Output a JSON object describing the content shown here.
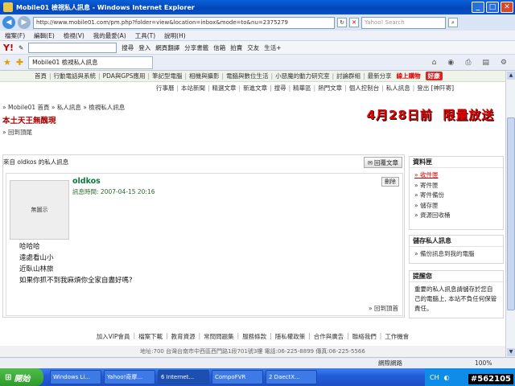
{
  "window": {
    "title": "Mobile01 檢視私人訊息 - Windows Internet Explorer"
  },
  "address": {
    "url": "http://www.mobile01.com/pm.php?folder=view&location=inbox&mode=to&nu=2375279",
    "search_placeholder": "Yahoo! Search"
  },
  "menu": [
    "檔案(F)",
    "編輯(E)",
    "檢視(V)",
    "我的最愛(A)",
    "工具(T)",
    "說明(H)"
  ],
  "toolbar1": {
    "search_btn": "搜尋",
    "login": "登入",
    "translate": "網頁翻譯",
    "share": "分享書籤",
    "mail": "信箱",
    "auction": "拍賣",
    "friends": "交友",
    "life": "生活+"
  },
  "tab": {
    "label": "Mobile01 檢視私人訊息"
  },
  "sitenav": {
    "items": [
      "首頁",
      "行動電話與系統",
      "PDA與GPS應用",
      "筆記型電腦",
      "相機與攝影",
      "電腦與數位生活",
      "小惡魔的動力研究室",
      "討論群組",
      "最新分享"
    ],
    "highlight": "線上購物",
    "badge": "好康"
  },
  "subnav": {
    "items": [
      "行事曆",
      "本站新聞",
      "精選文章",
      "新進文章",
      "搜尋",
      "精華區",
      "熱門文章",
      "個人控制台",
      "私人訊息",
      "登出 [神阡寄]"
    ]
  },
  "breadcrumb": "» Mobile01 首頁 » 私人訊息 » 檢視私人訊息",
  "page_title": "本土天王無醜現",
  "back_link": "» 回到頂尾",
  "banner": {
    "text1": "4月28日前",
    "text2": "限量放送"
  },
  "message": {
    "from_label": "來自 oldkos 的私人訊息",
    "reply_label": "回覆文章",
    "avatar_text": "無圖示",
    "username": "oldkos",
    "time": "訊息時間: 2007-04-15 20:16",
    "delete_label": "刪除",
    "lines": [
      "哈哈哈",
      "遠處看山小",
      "近臥山林旅",
      "如果你抓不到我麻煩你全家自盡好嗎?"
    ],
    "back_top": "» 回到頂首"
  },
  "side_folders": {
    "title": "資料匣",
    "items": [
      "» 收件匣",
      "» 寄件匣",
      "» 寄件備份",
      "» 儲存匣",
      "» 資源回收桶"
    ]
  },
  "side_save": {
    "title": "儲存私人訊息",
    "items": [
      "» 備份訊息到我的電腦"
    ]
  },
  "side_notice": {
    "title": "提醒您",
    "text": "重要的私人訊息請儲存於您自己的電腦上, 本站不負任何保管責任。"
  },
  "footer": {
    "links": [
      "加入VIP會員",
      "檔案下載",
      "教育資源",
      "常問問題集",
      "服務條款",
      "隱私權政策",
      "合作與廣告",
      "聯絡我們",
      "工作機會"
    ],
    "address": "地址:700 台灣台南市中西區西門路1段701號3樓 電話:06-225-8899 傳真:06-225-5566"
  },
  "status": {
    "zone": "網際網路",
    "zoom": "100%"
  },
  "taskbar": {
    "start": "開始",
    "tasks": [
      "Windows Li...",
      "Yahoo!奇摩...",
      "6 Internet...",
      "CompoFVR",
      "2 DaectX..."
    ],
    "tray": "CH"
  },
  "watermark": "#562105"
}
